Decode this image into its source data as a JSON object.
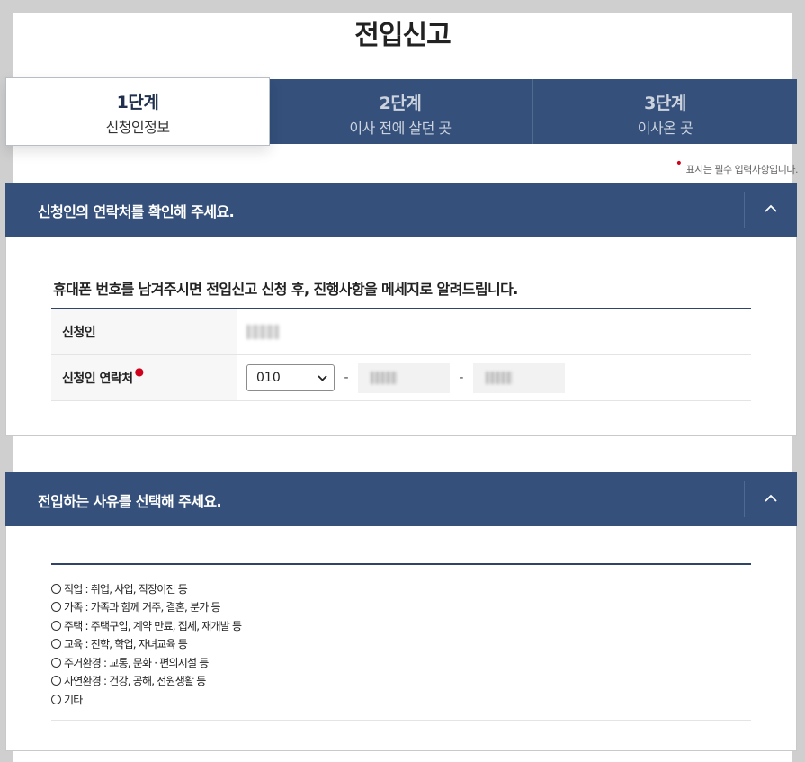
{
  "page": {
    "title": "전입신고"
  },
  "steps": [
    {
      "num": "1단계",
      "label": "신청인정보"
    },
    {
      "num": "2단계",
      "label": "이사 전에 살던 곳"
    },
    {
      "num": "3단계",
      "label": "이사온 곳"
    }
  ],
  "required_note": "표시는 필수 입력사항입니다.",
  "contact": {
    "heading": "신청인의 연락처를 확인해 주세요.",
    "lead": "휴대폰 번호를 남겨주시면 전입신고 신청 후, 진행사항을 메세지로 알려드립니다.",
    "applicant_label": "신청인",
    "phone_label": "신청인 연락처",
    "phone_prefix": "010",
    "dash": "-"
  },
  "reason": {
    "heading": "전입하는 사유를 선택해 주세요.",
    "options": [
      "직업 : 취업, 사업, 직장이전 등",
      "가족 : 가족과 함께 거주, 결혼, 분가 등",
      "주택 : 주택구입, 계약 만료, 집세, 재개발 등",
      "교육 : 진학, 학업, 자녀교육 등",
      "주거환경 : 교통, 문화 · 편의시설 등",
      "자연환경 : 건강, 공해, 전원생활 등",
      "기타"
    ]
  },
  "colors": {
    "header": "#34507b",
    "required": "#d0021b"
  }
}
